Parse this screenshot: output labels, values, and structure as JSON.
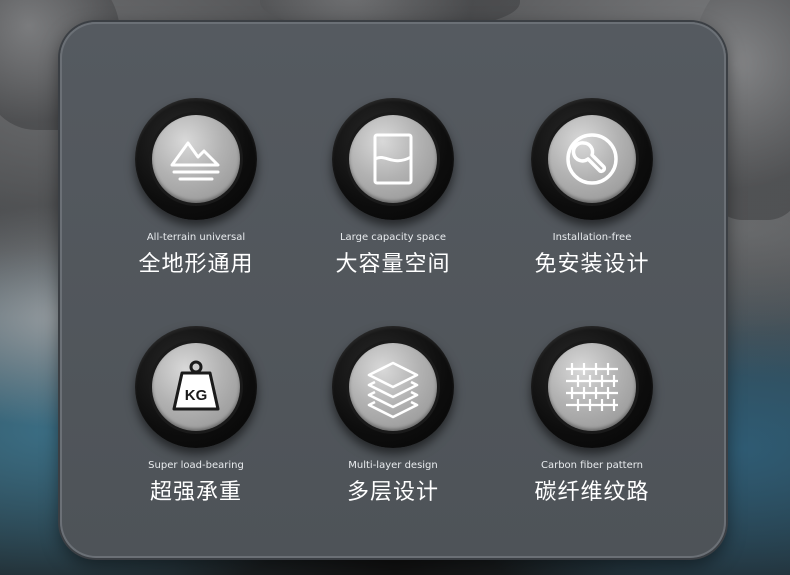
{
  "features": [
    {
      "en": "All-terrain universal",
      "cn": "全地形通用",
      "icon": "mountain-icon"
    },
    {
      "en": "Large capacity space",
      "cn": "大容量空间",
      "icon": "container-icon"
    },
    {
      "en": "Installation-free",
      "cn": "免安装设计",
      "icon": "wrench-icon"
    },
    {
      "en": "Super load-bearing",
      "cn": "超强承重",
      "icon": "weight-icon",
      "icon_text": "KG"
    },
    {
      "en": "Multi-layer design",
      "cn": "多层设计",
      "icon": "layers-icon"
    },
    {
      "en": "Carbon fiber pattern",
      "cn": "碳纤维纹路",
      "icon": "carbon-fiber-icon"
    }
  ]
}
